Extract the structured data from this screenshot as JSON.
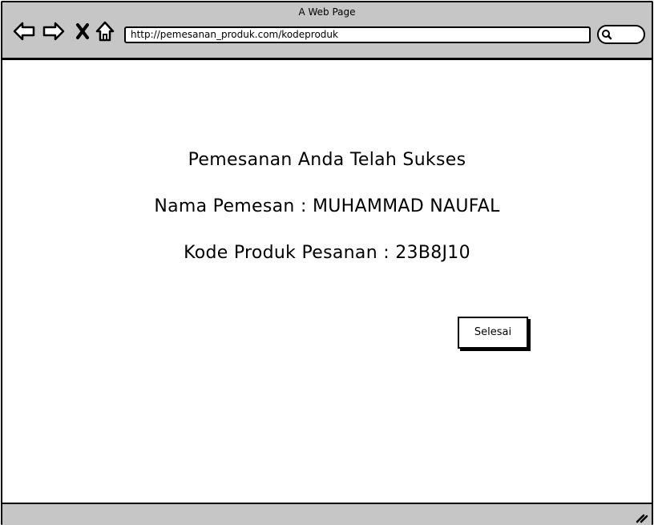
{
  "window": {
    "title": "A Web Page"
  },
  "toolbar": {
    "back_icon": "back-arrow-icon",
    "forward_icon": "forward-arrow-icon",
    "stop_icon": "close-x-icon",
    "home_icon": "home-icon",
    "url": "http://pemesanan_produk.com/kodeproduk",
    "search_icon": "search-icon"
  },
  "main": {
    "heading": "Pemesanan Anda Telah Sukses",
    "customer_line": "Nama Pemesan : MUHAMMAD NAUFAL",
    "product_line": "Kode Produk Pesanan : 23B8J10",
    "finish_button": "Selesai"
  },
  "colors": {
    "chrome": "#c6c6c6",
    "border": "#000000",
    "background": "#ffffff"
  }
}
